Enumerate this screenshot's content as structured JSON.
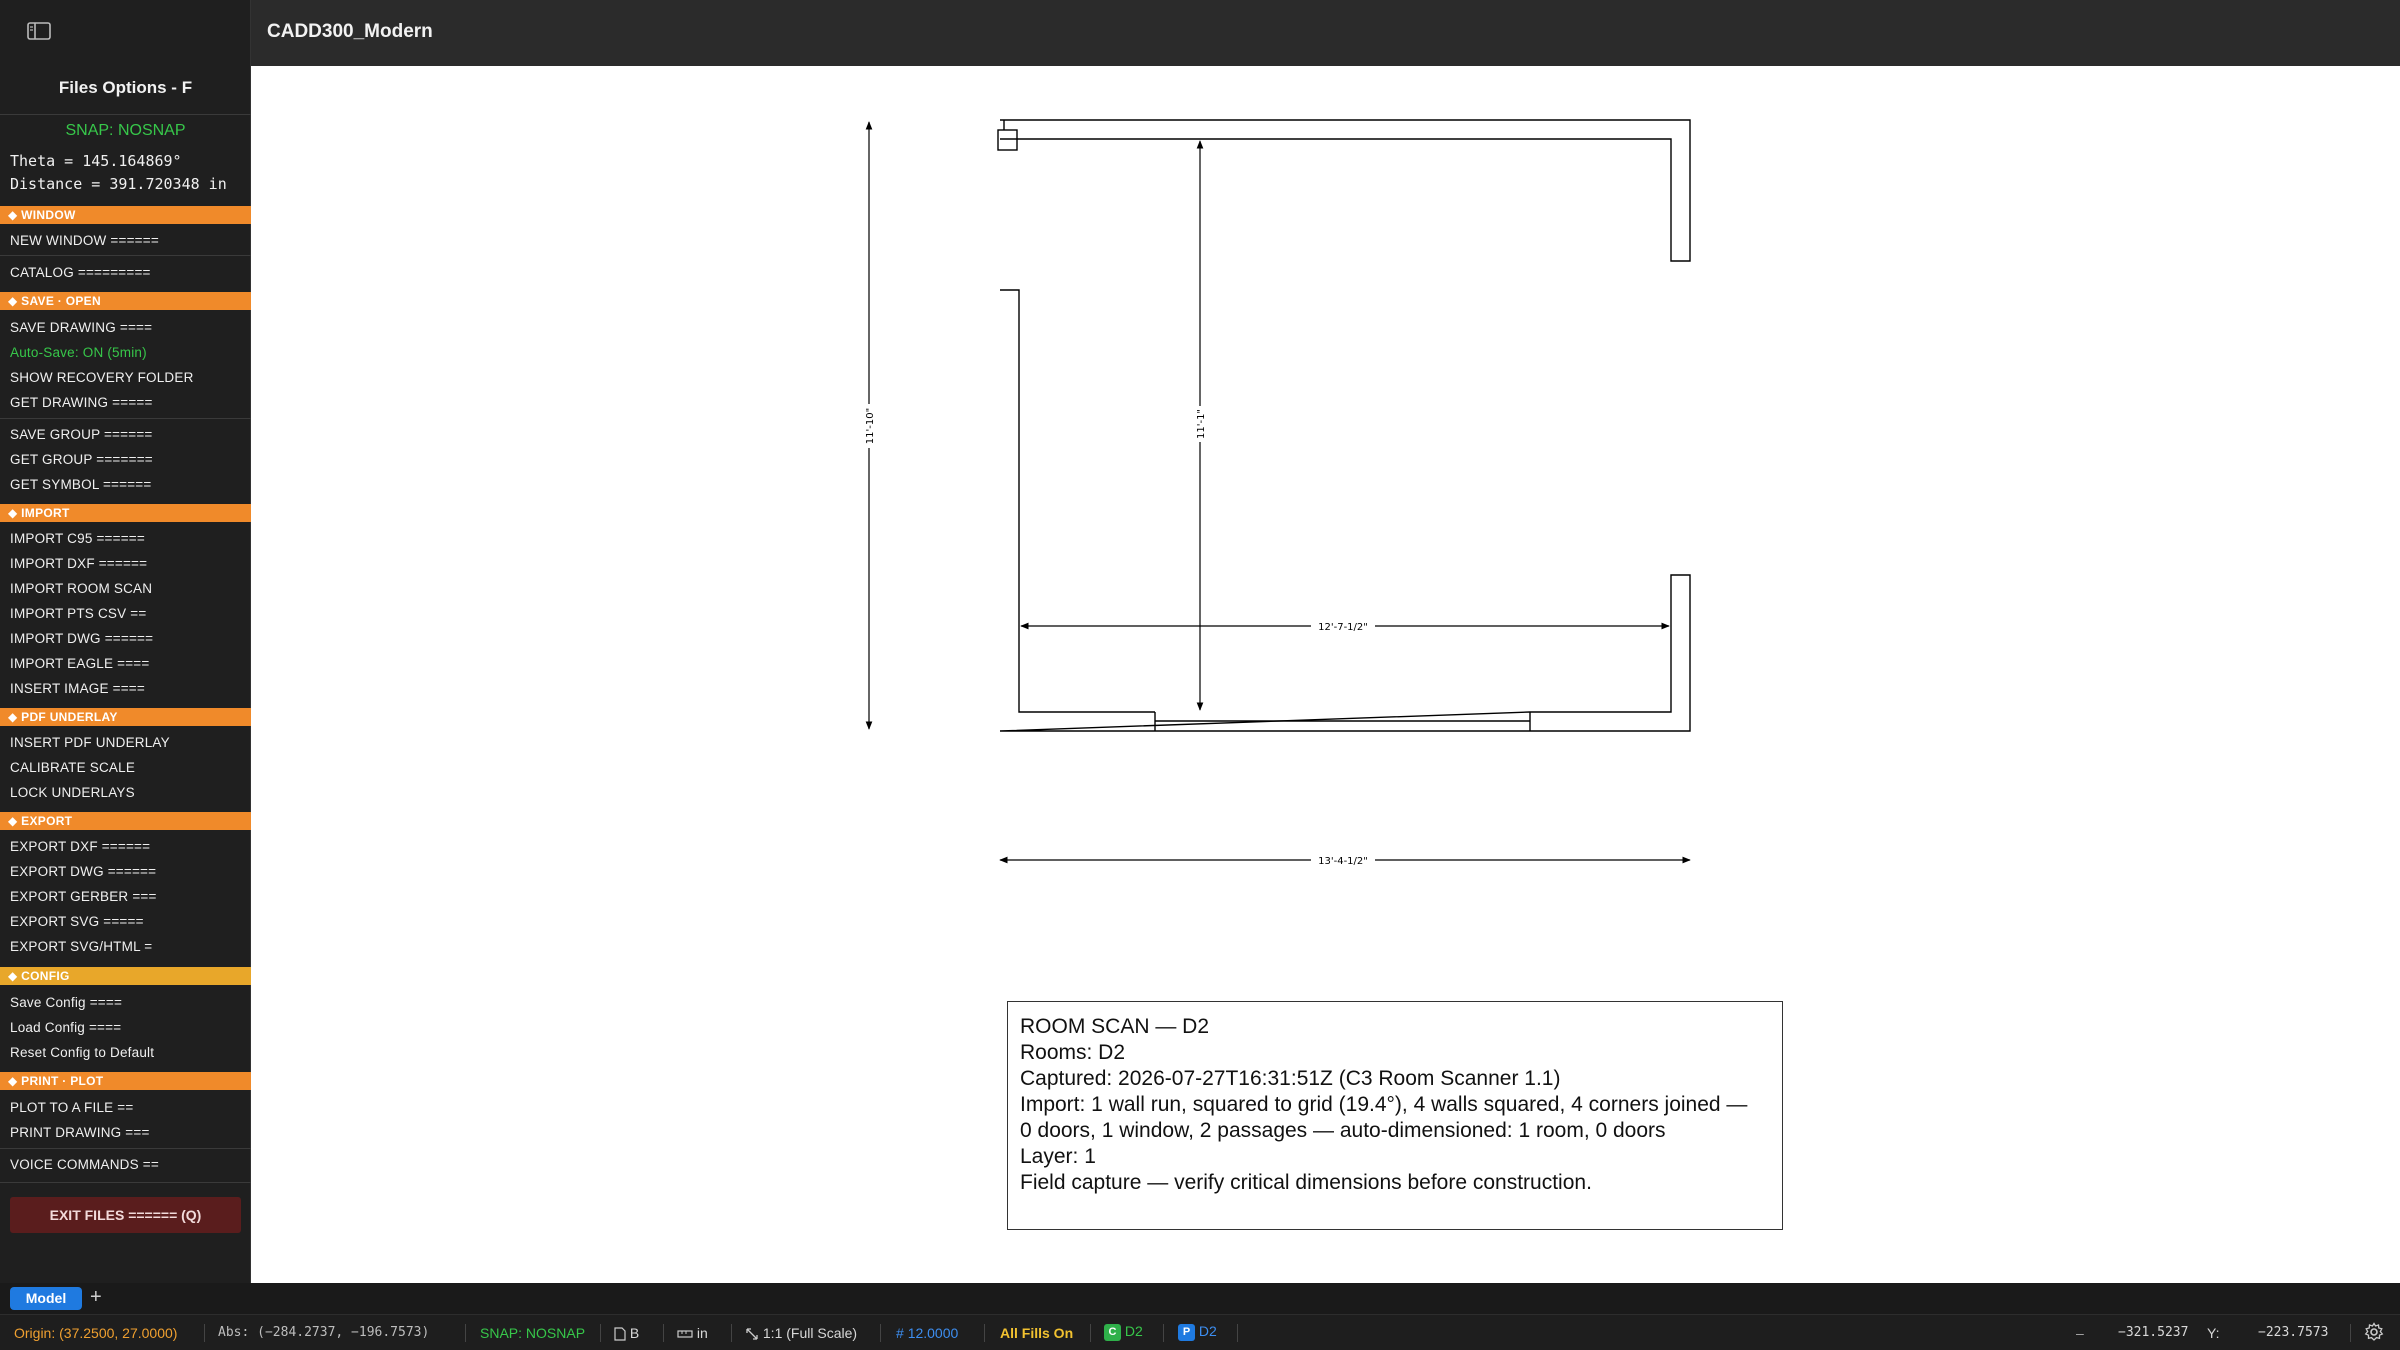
{
  "app": {
    "drawing_title": "CADD300_Modern"
  },
  "sidebar": {
    "panel_title": "Files Options - F",
    "snap_status": "SNAP: NOSNAP",
    "theta": "Theta = 145.164869°",
    "distance": "Distance = 391.720348 in",
    "sections": {
      "window": "◆ WINDOW",
      "save_open": "◆ SAVE · OPEN",
      "import": "◆ IMPORT",
      "pdf_underlay": "◆ PDF UNDERLAY",
      "export": "◆ EXPORT",
      "config": "◆ CONFIG",
      "print_plot": "◆ PRINT · PLOT"
    },
    "items": {
      "new_window": "NEW WINDOW ======",
      "catalog": "CATALOG =========",
      "save_drawing": "SAVE DRAWING ====",
      "auto_save": "Auto-Save: ON (5min)",
      "show_recovery": "SHOW RECOVERY FOLDER",
      "get_drawing": "GET DRAWING =====",
      "save_group": "SAVE GROUP ======",
      "get_group": "GET GROUP =======",
      "get_symbol": "GET SYMBOL ======",
      "import_c95": "IMPORT C95 ======",
      "import_dxf": "IMPORT DXF ======",
      "import_room_scan": "IMPORT ROOM SCAN",
      "import_pts_csv": "IMPORT PTS CSV ==",
      "import_dwg": "IMPORT DWG ======",
      "import_eagle": "IMPORT EAGLE ====",
      "insert_image": "INSERT IMAGE ====",
      "insert_pdf_underlay": "INSERT PDF UNDERLAY",
      "calibrate_scale": "CALIBRATE SCALE",
      "lock_underlays": "LOCK UNDERLAYS",
      "export_dxf": "EXPORT DXF ======",
      "export_dwg": "EXPORT DWG ======",
      "export_gerber": "EXPORT GERBER ===",
      "export_svg": "EXPORT SVG =====",
      "export_svg_html": "EXPORT SVG/HTML =",
      "save_config": "Save Config ====",
      "load_config": "Load Config ====",
      "reset_config": "Reset Config to Default",
      "plot_to_file": "PLOT TO A FILE ==",
      "print_drawing": "PRINT DRAWING ===",
      "voice_commands": "VOICE COMMANDS =="
    },
    "exit_button": "EXIT FILES ====== (Q)"
  },
  "drawing": {
    "dimensions": {
      "left_vertical": "11'-10\"",
      "inner_vertical": "11'-1\"",
      "inner_horizontal": "12'-7-1/2\"",
      "bottom_horizontal": "13'-4-1/2\""
    },
    "info_box": {
      "line1": "ROOM SCAN — D2",
      "line2": "Rooms: D2",
      "line3": "Captured: 2026-07-27T16:31:51Z (C3 Room Scanner 1.1)",
      "line4": "Import: 1 wall run, squared to grid (19.4°), 4 walls squared, 4 corners joined —",
      "line5": "0 doors, 1 window, 2 passages — auto-dimensioned: 1 room, 0 doors",
      "line6": "Layer: 1",
      "line7": "Field capture — verify critical dimensions before construction."
    }
  },
  "tabs": {
    "model": "Model",
    "add": "+"
  },
  "status_bar": {
    "origin": "Origin: (37.2500, 27.0000)",
    "abs": "Abs: (−284.2737, −196.7573)",
    "snap": "SNAP: NOSNAP",
    "paper": "B",
    "units": "in",
    "scale": "1:1 (Full Scale)",
    "grid": "12.0000",
    "fills": "All Fills On",
    "c_badge": "C",
    "c_layer": "D2",
    "p_badge": "P",
    "p_layer": "D2",
    "dash": "–",
    "x_coord": "−321.5237",
    "y_label": "Y:",
    "y_coord": "−223.7573"
  },
  "colors": {
    "accent_orange": "#f08a2a",
    "snap_green": "#37c74a",
    "tab_blue": "#1f7ae0",
    "origin_orange": "#f0a030",
    "fills_yellow": "#f2c230"
  }
}
